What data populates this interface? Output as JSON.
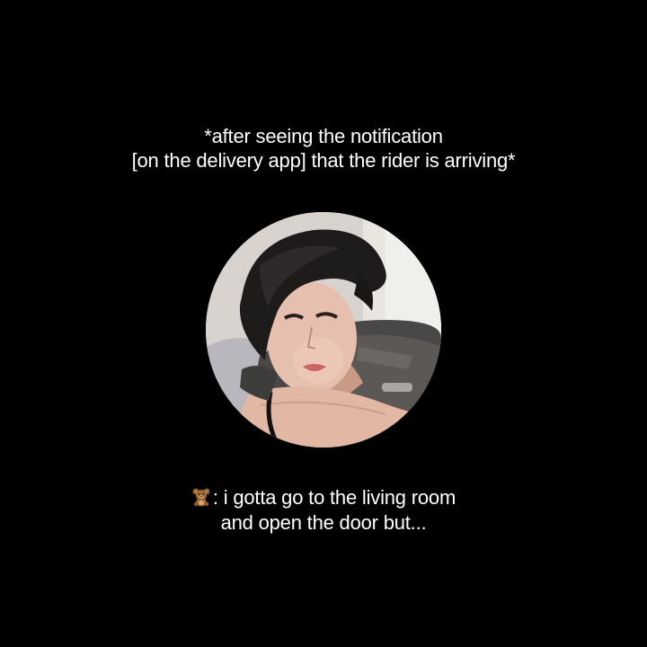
{
  "caption_top": {
    "line1": "*after seeing the notification",
    "line2": "[on the delivery app] that the rider is arriving*"
  },
  "avatar": {
    "icon": "person-portrait-photo"
  },
  "caption_bottom": {
    "speaker_icon": "teddy-bear-icon",
    "line1": ": i gotta go to the living room",
    "line2": "and open the door but..."
  },
  "colors": {
    "background": "#000000",
    "text": "#ffffff"
  }
}
